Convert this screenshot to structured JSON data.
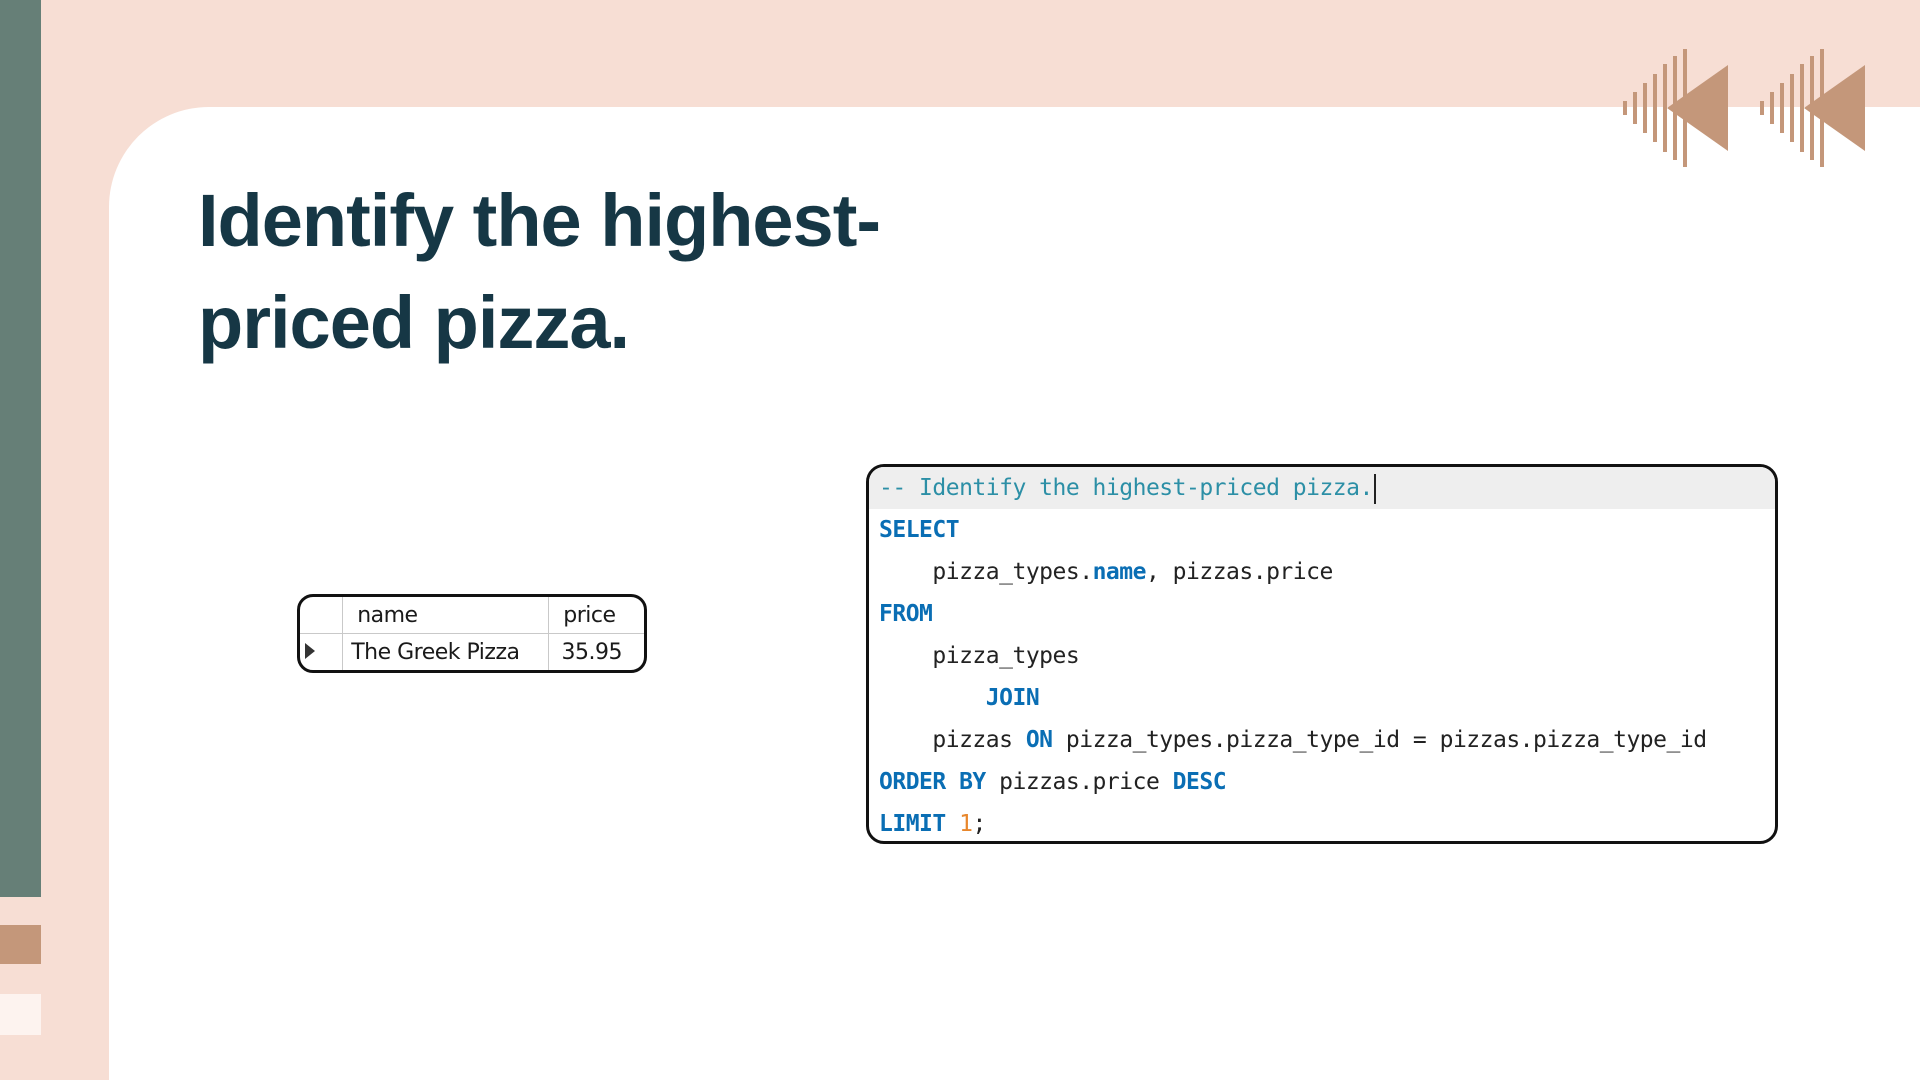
{
  "slide": {
    "title": "Identify the highest-priced pizza."
  },
  "result_grid": {
    "columns": [
      "name",
      "price"
    ],
    "rows": [
      {
        "name": "The Greek Pizza",
        "price": "35.95"
      }
    ]
  },
  "sql_editor": {
    "comment": "-- Identify the highest-priced pizza.",
    "kw_select": "SELECT",
    "select_indent": "    ",
    "select_table": "pizza_types.",
    "select_name_kw": "name",
    "select_rest": ", pizzas.price",
    "kw_from": "FROM",
    "from_line": "    pizza_types",
    "join_indent": "        ",
    "kw_join": "JOIN",
    "on_indent": "    ",
    "on_table": "pizzas ",
    "kw_on": "ON",
    "on_condition": " pizza_types.pizza_type_id = pizzas.pizza_type_id",
    "kw_order_by": "ORDER BY",
    "order_expr": " pizzas.price ",
    "kw_desc": "DESC",
    "kw_limit": "LIMIT",
    "limit_space": " ",
    "limit_value": "1",
    "limit_end": ";"
  },
  "colors": {
    "background": "#f7ded4",
    "sidebar": "#667f77",
    "accent": "#c4977a",
    "title": "#163745",
    "sql_keyword": "#0a6eb4",
    "sql_comment": "#2c8fa6",
    "sql_number": "#e8872c"
  },
  "decoration": {
    "icons": [
      "chevron-left-decor-icon",
      "chevron-left-decor-icon"
    ]
  }
}
